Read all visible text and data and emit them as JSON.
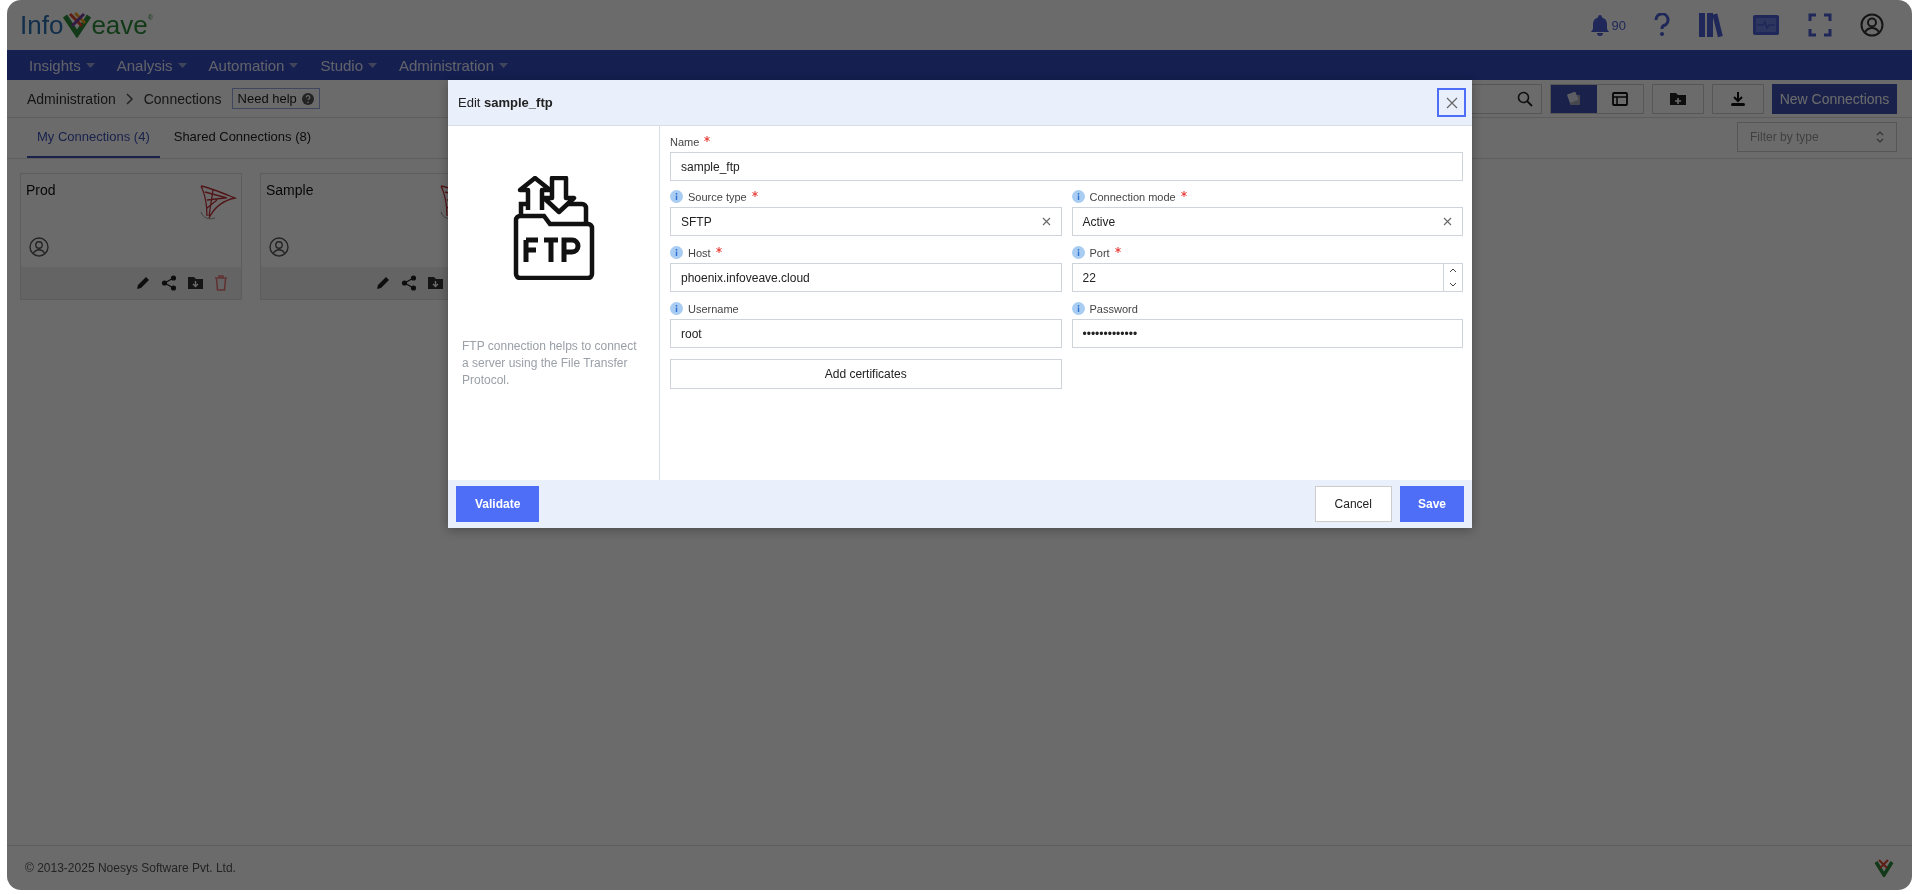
{
  "header": {
    "logo": {
      "part_1": "Info",
      "part_2": "eave",
      "mark": "®"
    },
    "notification_count": "90"
  },
  "nav": [
    {
      "label": "Insights"
    },
    {
      "label": "Analysis"
    },
    {
      "label": "Automation"
    },
    {
      "label": "Studio"
    },
    {
      "label": "Administration"
    }
  ],
  "breadcrumb": [
    "Administration",
    "Connections"
  ],
  "help_button": "Need help",
  "toolbar": {
    "view_buttons": [
      {
        "kind": "grid",
        "selected": true
      },
      {
        "kind": "list",
        "selected": false
      }
    ],
    "new_button": "New Connections"
  },
  "tabs": [
    {
      "label": "My Connections (4)",
      "selected": true
    },
    {
      "label": "Shared Connections (8)",
      "selected": false
    }
  ],
  "filter": {
    "placeholder": "Filter by type"
  },
  "cards": [
    {
      "name": "Prod",
      "actions": [
        {
          "kind": "edit"
        },
        {
          "kind": "share"
        },
        {
          "kind": "download"
        },
        {
          "kind": "delete"
        }
      ]
    },
    {
      "name": "Sample",
      "actions": [
        {
          "kind": "edit"
        },
        {
          "kind": "share"
        },
        {
          "kind": "download"
        }
      ]
    }
  ],
  "modal": {
    "title_prefix": "Edit",
    "title_name": "sample_ftp",
    "description": "FTP connection helps to connect a server using the File Transfer Protocol.",
    "name_field": {
      "label": "Name",
      "required": true,
      "value": "sample_ftp"
    },
    "fields": [
      {
        "label": "Source type",
        "required": true,
        "info": true,
        "value": "SFTP",
        "kind": "select"
      },
      {
        "label": "Connection mode",
        "required": true,
        "info": true,
        "value": "Active",
        "kind": "select"
      },
      {
        "label": "Host",
        "required": true,
        "info": true,
        "value": "phoenix.infoveave.cloud",
        "kind": "text"
      },
      {
        "label": "Port",
        "required": true,
        "info": true,
        "value": "22",
        "kind": "number"
      },
      {
        "label": "Username",
        "required": false,
        "info": true,
        "value": "root",
        "kind": "text"
      },
      {
        "label": "Password",
        "required": false,
        "info": true,
        "value": "•••••••••••••",
        "kind": "password"
      }
    ],
    "add_certificates": "Add certificates",
    "validate_button": "Validate",
    "cancel_button": "Cancel",
    "save_button": "Save"
  },
  "footer": {
    "copyright": "© 2013-2025 Noesys Software Pvt. Ltd."
  }
}
